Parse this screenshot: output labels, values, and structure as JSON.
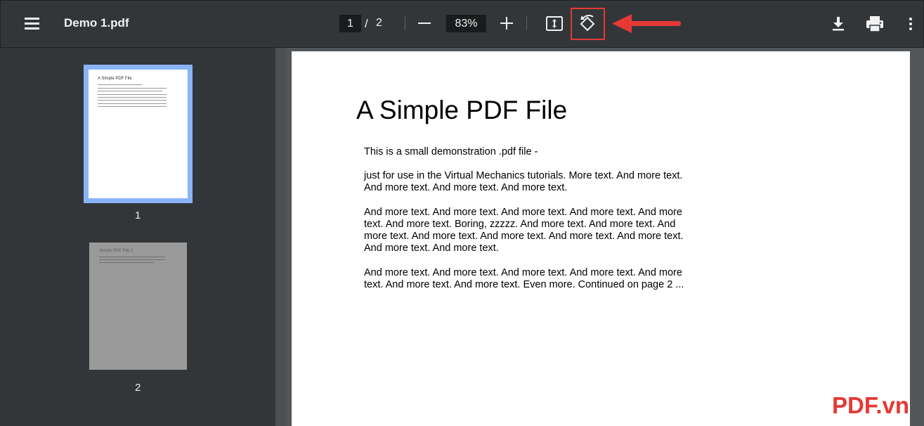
{
  "toolbar": {
    "title": "Demo 1.pdf",
    "current_page": "1",
    "page_separator": "/",
    "total_pages": "2",
    "zoom": "83%",
    "icons": [
      "menu-icon",
      "zoom-out-icon",
      "zoom-in-icon",
      "fit-to-page-icon",
      "rotate-icon",
      "download-icon",
      "print-icon",
      "more-options-icon"
    ]
  },
  "sidebar": {
    "thumbnails": [
      {
        "label": "1",
        "title": "A Simple PDF File",
        "selected": true
      },
      {
        "label": "2",
        "title": "Simple PDF File 2",
        "selected": false
      }
    ]
  },
  "document": {
    "title": "A Simple PDF File",
    "paragraphs": [
      "This is a small demonstration .pdf file -",
      "just for use in the Virtual Mechanics tutorials. More text. And more text. And more text. And more text. And more text.",
      "And more text. And more text. And more text. And more text. And more text. And more text. Boring, zzzzz. And more text. And more text. And more text. And more text. And more text. And more text. And more text. And more text. And more text.",
      "And more text. And more text. And more text. And more text. And more text. And more text. And more text. Even more. Continued on page 2 ..."
    ]
  },
  "watermark": "PDF.vn",
  "colors": {
    "toolbar_bg": "#323639",
    "viewer_bg": "#525659",
    "thumbnail_selected": "#8ab4f8",
    "highlight": "#e53935"
  }
}
